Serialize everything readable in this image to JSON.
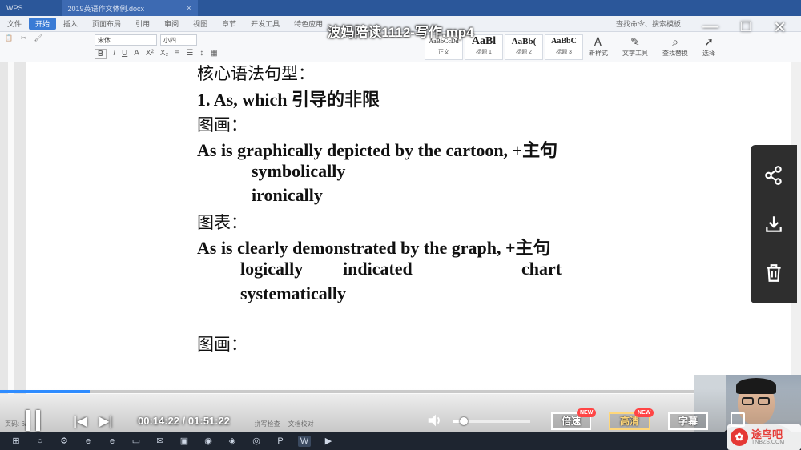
{
  "video": {
    "title": "波妈陪读1112-写作.mp4",
    "time_current": "00:14:22",
    "time_total": "01:51:22",
    "progress": 0.129,
    "volume": 0.14
  },
  "window_controls": {
    "minimize": "—",
    "restore": "□",
    "close": "✕"
  },
  "wps": {
    "app_label": "WPS",
    "doc_tab": "2019英语作文体例.docx",
    "menu": [
      "文件",
      "开始",
      "插入",
      "页面布局",
      "引用",
      "审阅",
      "视图",
      "章节",
      "开发工具",
      "特色应用"
    ],
    "menu_active": "开始",
    "search_hint": "查找命令、搜索模板",
    "font_name": "宋体",
    "font_size": "小四",
    "styles": [
      {
        "preview": "AaBbCcDd",
        "name": "正文"
      },
      {
        "preview": "AaBl",
        "name": "标题 1"
      },
      {
        "preview": "AaBb(",
        "name": "标题 2"
      },
      {
        "preview": "AaBbC",
        "name": "标题 3"
      }
    ],
    "tools": [
      {
        "icon": "Ꭺ",
        "label": "新样式"
      },
      {
        "icon": "✎",
        "label": "文字工具"
      },
      {
        "icon": "⌕",
        "label": "查找替换"
      },
      {
        "icon": "➚",
        "label": "选择"
      }
    ],
    "status": {
      "page": "页码: 6/6",
      "spell": "拼写检查",
      "proof": "文档校对"
    }
  },
  "document": {
    "lines": [
      "核心语法句型：",
      "1.  As, which  引导的非限",
      "图画：",
      "As is graphically depicted by the cartoon, +主句",
      "symbolically",
      "ironically",
      "图表：",
      "As is clearly demonstrated by the graph, +主句",
      "logically",
      "indicated",
      "chart",
      "systematically",
      "图画："
    ]
  },
  "player_buttons": {
    "speed": "倍速",
    "quality": "高清",
    "subtitles": "字幕",
    "new_badge": "NEW"
  },
  "side_panel": [
    "share-icon",
    "download-icon",
    "delete-icon"
  ],
  "watermark": {
    "text": "途鸟吧",
    "sub": "TNBZS.COM"
  }
}
